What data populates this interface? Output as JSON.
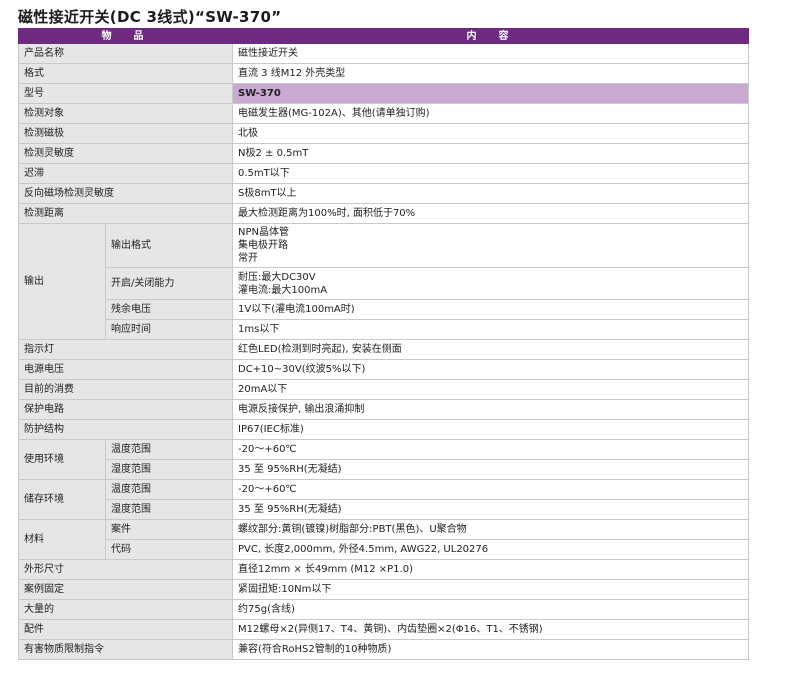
{
  "title": "磁性接近开关(DC 3线式)“SW-370”",
  "header": {
    "item": "物　品",
    "content": "内　容"
  },
  "rows": {
    "name": {
      "label": "产品名称",
      "value": "磁性接近开关"
    },
    "format": {
      "label": "格式",
      "value": "直流 3 线M12 外壳类型"
    },
    "model": {
      "label": "型号",
      "value": "SW-370"
    },
    "target": {
      "label": "检测对象",
      "value": "电磁发生器(MG-102A)、其他(请单独订购)"
    },
    "pole": {
      "label": "检测磁极",
      "value": "北极"
    },
    "sensitivity": {
      "label": "检测灵敏度",
      "value": "N极2 ± 0.5mT"
    },
    "hysteresis": {
      "label": "迟滞",
      "value": "0.5mT以下"
    },
    "reverse": {
      "label": "反向磁场检测灵敏度",
      "value": "S极8mT以上"
    },
    "distance": {
      "label": "检测距离",
      "value": "最大检测距离为100%时, 面积低于70%"
    },
    "output": {
      "label": "输出",
      "format": {
        "label": "输出格式",
        "value": "NPN晶体管\n集电极开路\n常开"
      },
      "capacity": {
        "label": "开启/关闭能力",
        "value": "耐压:最大DC30V\n灌电流:最大100mA"
      },
      "residual": {
        "label": "残余电压",
        "value": "1V以下(灌电流100mA时)"
      },
      "response": {
        "label": "响应时间",
        "value": "1ms以下"
      }
    },
    "indicator": {
      "label": "指示灯",
      "value": "红色LED(检测到时亮起), 安装在侧面"
    },
    "voltage": {
      "label": "电源电压",
      "value": "DC+10~30V(纹波5%以下)"
    },
    "consumption": {
      "label": "目前的消费",
      "value": "20mA以下"
    },
    "protection": {
      "label": "保护电路",
      "value": "电源反接保护, 输出浪涌抑制"
    },
    "structure": {
      "label": "防护结构",
      "value": "IP67(IEC标准)"
    },
    "use_env": {
      "label": "使用环境",
      "temp": {
        "label": "温度范围",
        "value": "-20～+60℃"
      },
      "humidity": {
        "label": "湿度范围",
        "value": "35 至 95%RH(无凝结)"
      }
    },
    "store_env": {
      "label": "储存环境",
      "temp": {
        "label": "温度范围",
        "value": "-20～+60℃"
      },
      "humidity": {
        "label": "湿度范围",
        "value": "35 至 95%RH(无凝结)"
      }
    },
    "material": {
      "label": "材料",
      "case": {
        "label": "案件",
        "value": "螺纹部分:黄铜(镀镍)树脂部分:PBT(黑色)、U聚合物"
      },
      "cable": {
        "label": "代码",
        "value": "PVC, 长度2,000mm, 外径4.5mm, AWG22, UL20276"
      }
    },
    "dimensions": {
      "label": "外形尺寸",
      "value": "直径12mm × 长49mm (M12 ×P1.0)"
    },
    "fixing": {
      "label": "案例固定",
      "value": "紧固扭矩:10Nm以下"
    },
    "mass": {
      "label": "大量的",
      "value": "约75g(含线)"
    },
    "accessories": {
      "label": "配件",
      "value": "M12螺母×2(异侧17、T4、黄铜)、内齿垫圈×2(Φ16、T1、不锈钢)"
    },
    "rohs": {
      "label": "有害物质限制指令",
      "value": "兼容(符合RoHS2管制的10种物质)"
    }
  },
  "colors": {
    "header_bg": "#6e2a81",
    "model_highlight": "#c9a8d2",
    "label_bg": "#e6e6e6"
  }
}
